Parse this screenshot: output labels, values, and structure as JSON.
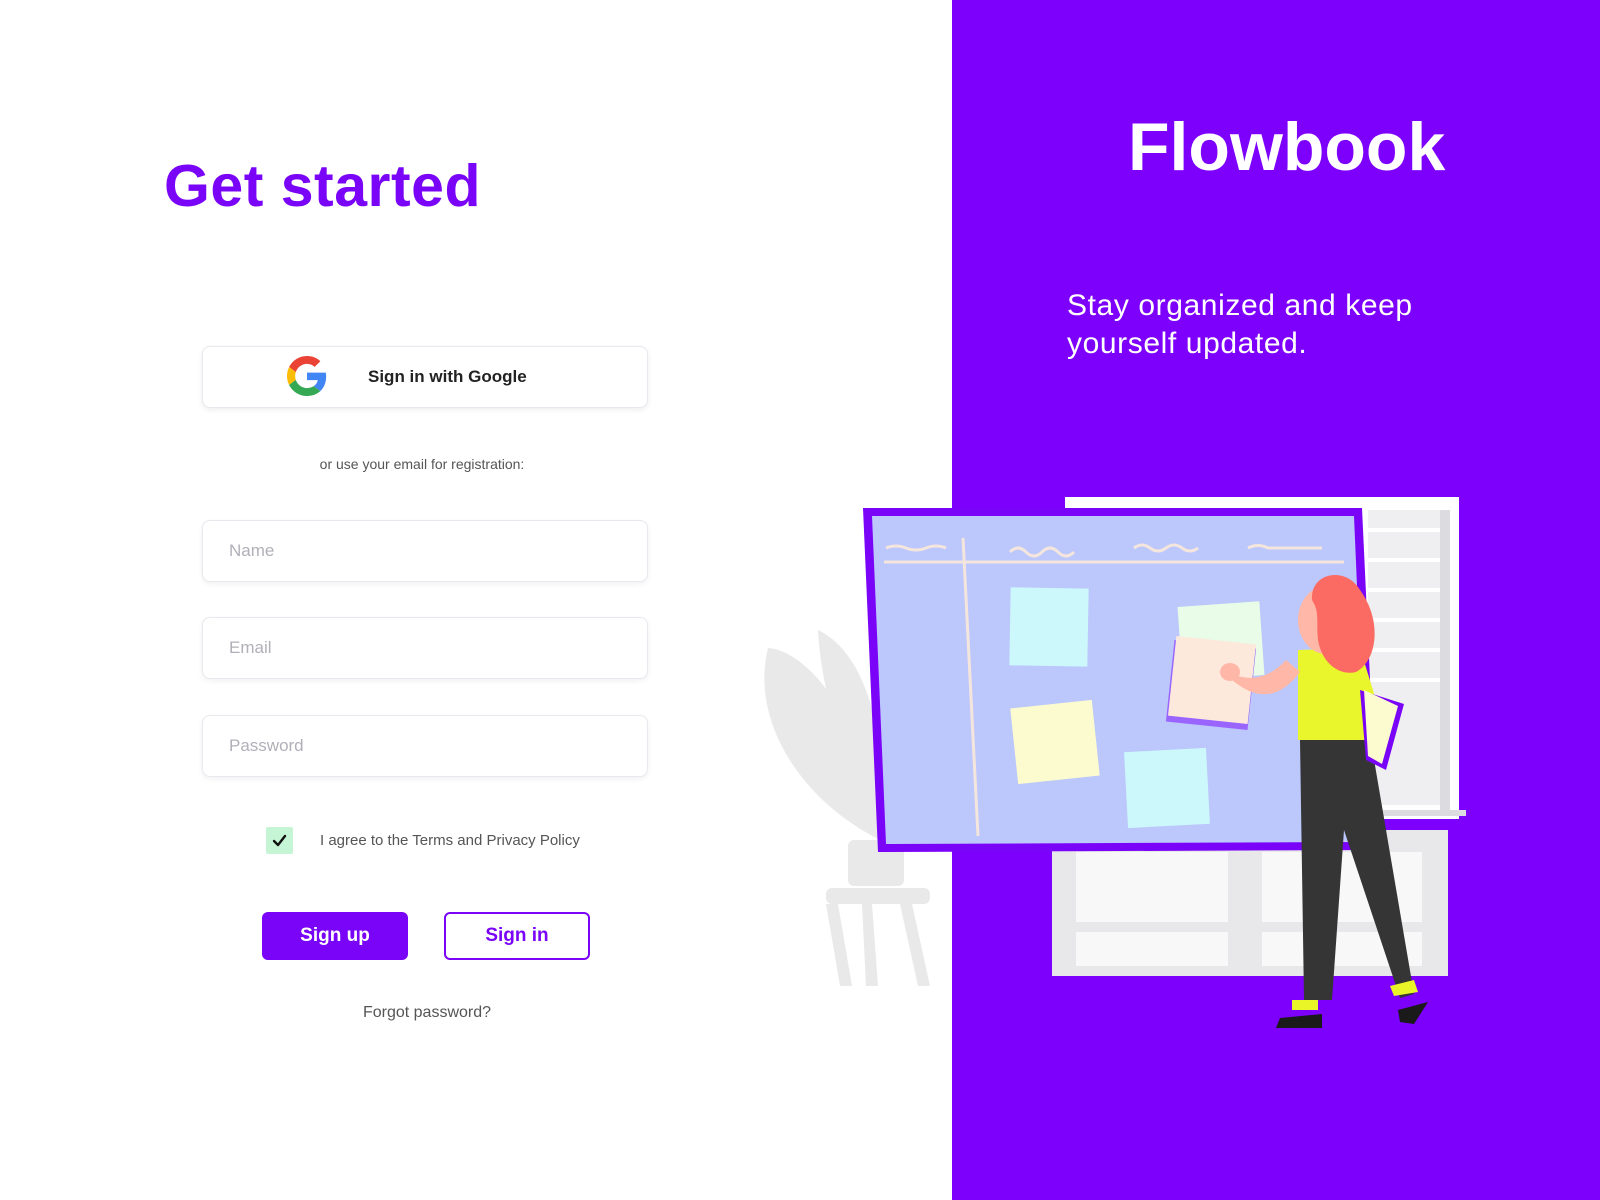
{
  "colors": {
    "brand_purple": "#7d00fd",
    "title_purple": "#7a04f7",
    "checkbox_green": "#c6f5d5",
    "board_fill": "#bcc7fb"
  },
  "left": {
    "title": "Get started",
    "google_button_label": "Sign in with Google",
    "google_icon": "google-g-icon",
    "divider_text": "or use your email for registration:",
    "fields": {
      "name_placeholder": "Name",
      "email_placeholder": "Email",
      "password_placeholder": "Password"
    },
    "agree": {
      "checked": true,
      "label": "I agree to the Terms and Privacy Policy",
      "icon": "checkmark-icon"
    },
    "signup_label": "Sign up",
    "signin_label": "Sign in",
    "forgot_label": "Forgot password?"
  },
  "right": {
    "brand": "Flowbook",
    "tagline": "Stay organized and keep yourself updated.",
    "illustration": "woman-with-sticky-note-board-illustration"
  }
}
